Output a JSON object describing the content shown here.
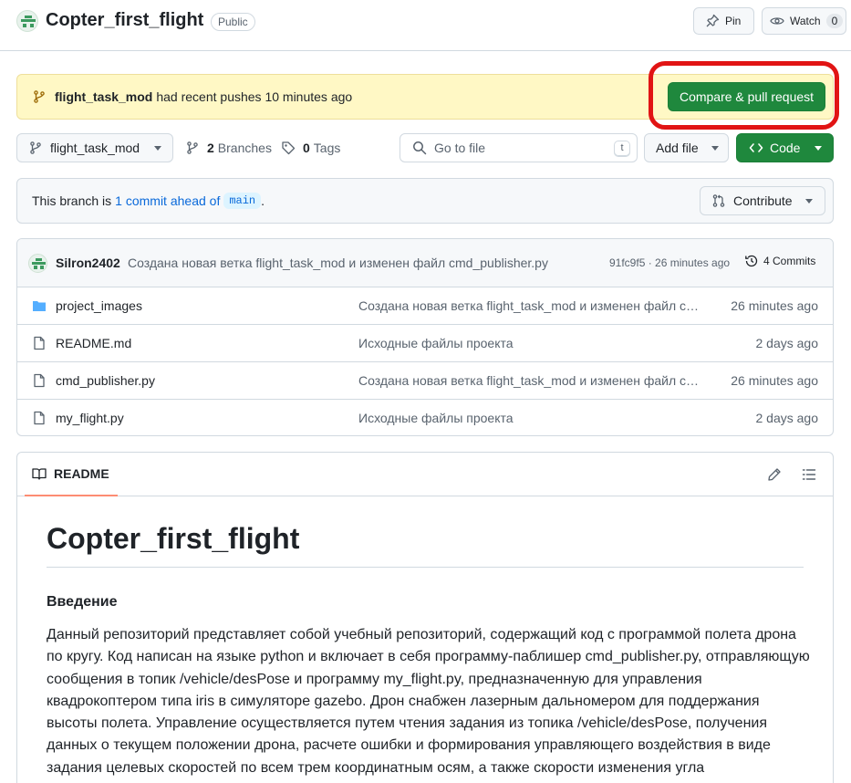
{
  "repo": {
    "name": "Copter_first_flight",
    "visibility": "Public",
    "pin_label": "Pin",
    "watch_label": "Watch",
    "watch_count": "0"
  },
  "push_banner": {
    "branch": "flight_task_mod",
    "text": "had recent pushes 10 minutes ago",
    "button": "Compare & pull request"
  },
  "toolbar": {
    "branch": "flight_task_mod",
    "branches_count": "2",
    "branches_label": "Branches",
    "tags_count": "0",
    "tags_label": "Tags",
    "goto_placeholder": "Go to file",
    "goto_shortcut": "t",
    "add_file": "Add file",
    "code": "Code"
  },
  "ahead": {
    "prefix": "This branch is",
    "link": "1 commit ahead of",
    "base": "main",
    "suffix": ".",
    "contribute": "Contribute"
  },
  "latest_commit": {
    "author": "Silron2402",
    "message": "Создана новая ветка flight_task_mod и изменен файл cmd_publisher.py",
    "hash_time": "91fc9f5 · 26 minutes ago",
    "commits": "4 Commits"
  },
  "files": [
    {
      "name": "project_images",
      "type": "folder",
      "message": "Создана новая ветка flight_task_mod и изменен файл cmd_publisher.py",
      "age": "26 minutes ago"
    },
    {
      "name": "README.md",
      "type": "file",
      "message": "Исходные файлы проекта",
      "age": "2 days ago"
    },
    {
      "name": "cmd_publisher.py",
      "type": "file",
      "message": "Создана новая ветка flight_task_mod и изменен файл cmd_publisher.py",
      "age": "26 minutes ago"
    },
    {
      "name": "my_flight.py",
      "type": "file",
      "message": "Исходные файлы проекта",
      "age": "2 days ago"
    }
  ],
  "readme": {
    "tab": "README",
    "title": "Copter_first_flight",
    "section": "Введение",
    "paragraph": "Данный репозиторий представляет собой учебный репозиторий, содержащий код с программой полета дрона по кругу. Код написан на языке python и включает в себя программу-паблишер cmd_publisher.py, отправляющую сообщения в топик /vehicle/desPose и программу my_flight.py, предназначенную для управления квадрокоптером типа iris в симуляторе gazebo. Дрон снабжен лазерным дальномером для поддержания высоты полета. Управление осуществляется путем чтения задания из топика /vehicle/desPose, получения данных о текущем положении дрона, расчете ошибки и формирования управляющего воздействия в виде задания целевых скоростей по всем трем координатным осям, а также скорости изменения угла"
  },
  "colors": {
    "accent_green": "#1f883d",
    "link_blue": "#0969da",
    "banner_yellow": "#fff8c5",
    "highlight_red": "#e11414"
  }
}
